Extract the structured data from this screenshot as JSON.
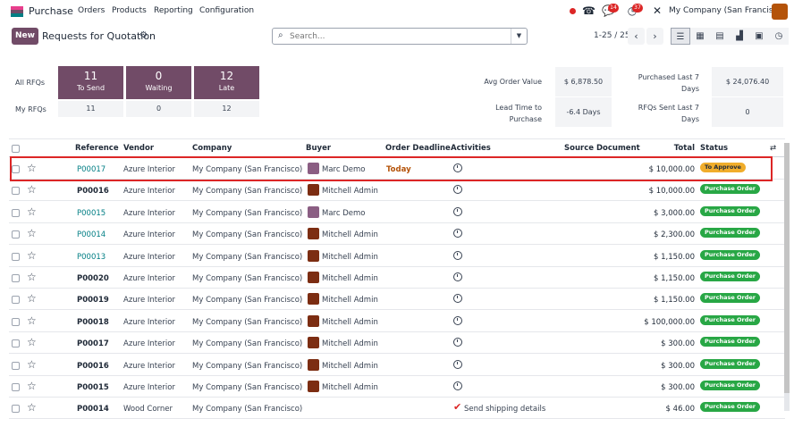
{
  "nav": {
    "app_name": "Purchase",
    "menu": [
      "Orders",
      "Products",
      "Reporting",
      "Configuration"
    ],
    "messages_badge": "14",
    "activities_badge": "37",
    "company": "My Company (San Francisco)"
  },
  "control": {
    "new_label": "New",
    "title": "Requests for Quotation",
    "search_placeholder": "Search...",
    "pager": "1-25 / 25"
  },
  "dashboard": {
    "all_rfqs_label": "All RFQs",
    "my_rfqs_label": "My RFQs",
    "cards": [
      {
        "num": "11",
        "label": "To Send",
        "my": "11"
      },
      {
        "num": "0",
        "label": "Waiting",
        "my": "0"
      },
      {
        "num": "12",
        "label": "Late",
        "my": "12"
      }
    ],
    "avg_order_label": "Avg Order Value",
    "avg_order_value": "$ 6,878.50",
    "lead_time_label": "Lead Time to Purchase",
    "lead_time_value": "-6.4 Days",
    "purchased_label": "Purchased Last 7 Days",
    "purchased_value": "$ 24,076.40",
    "rfqs_sent_label": "RFQs Sent Last 7 Days",
    "rfqs_sent_value": "0"
  },
  "table": {
    "headers": [
      "Reference",
      "Vendor",
      "Company",
      "Buyer",
      "Order Deadline",
      "Activities",
      "Source Document",
      "Total",
      "Status"
    ],
    "rows": [
      {
        "ref": "P00017",
        "vendor": "Azure Interior",
        "company": "My Company (San Francisco)",
        "buyer": "Marc Demo",
        "deadline": "Today",
        "total": "$ 10,000.00",
        "status": "To Approve"
      },
      {
        "ref": "P00016",
        "vendor": "Azure Interior",
        "company": "My Company (San Francisco)",
        "buyer": "Mitchell Admin",
        "deadline": "",
        "total": "$ 10,000.00",
        "status": "Purchase Order"
      },
      {
        "ref": "P00015",
        "vendor": "Azure Interior",
        "company": "My Company (San Francisco)",
        "buyer": "Marc Demo",
        "deadline": "",
        "total": "$ 3,000.00",
        "status": "Purchase Order"
      },
      {
        "ref": "P00014",
        "vendor": "Azure Interior",
        "company": "My Company (San Francisco)",
        "buyer": "Mitchell Admin",
        "deadline": "",
        "total": "$ 2,300.00",
        "status": "Purchase Order"
      },
      {
        "ref": "P00013",
        "vendor": "Azure Interior",
        "company": "My Company (San Francisco)",
        "buyer": "Mitchell Admin",
        "deadline": "",
        "total": "$ 1,150.00",
        "status": "Purchase Order"
      },
      {
        "ref": "P00020",
        "vendor": "Azure Interior",
        "company": "My Company (San Francisco)",
        "buyer": "Mitchell Admin",
        "deadline": "",
        "total": "$ 1,150.00",
        "status": "Purchase Order"
      },
      {
        "ref": "P00019",
        "vendor": "Azure Interior",
        "company": "My Company (San Francisco)",
        "buyer": "Mitchell Admin",
        "deadline": "",
        "total": "$ 1,150.00",
        "status": "Purchase Order"
      },
      {
        "ref": "P00018",
        "vendor": "Azure Interior",
        "company": "My Company (San Francisco)",
        "buyer": "Mitchell Admin",
        "deadline": "",
        "total": "$ 100,000.00",
        "status": "Purchase Order"
      },
      {
        "ref": "P00017",
        "vendor": "Azure Interior",
        "company": "My Company (San Francisco)",
        "buyer": "Mitchell Admin",
        "deadline": "",
        "total": "$ 300.00",
        "status": "Purchase Order"
      },
      {
        "ref": "P00016",
        "vendor": "Azure Interior",
        "company": "My Company (San Francisco)",
        "buyer": "Mitchell Admin",
        "deadline": "",
        "total": "$ 300.00",
        "status": "Purchase Order"
      },
      {
        "ref": "P00015",
        "vendor": "Azure Interior",
        "company": "My Company (San Francisco)",
        "buyer": "Mitchell Admin",
        "deadline": "",
        "total": "$ 300.00",
        "status": "Purchase Order"
      },
      {
        "ref": "P00014",
        "vendor": "Wood Corner",
        "company": "My Company (San Francisco)",
        "buyer": "",
        "deadline": "",
        "activity_text": "Send shipping details",
        "total": "$ 46.00",
        "status": "Purchase Order"
      }
    ]
  },
  "colors": {
    "brand": "#714B67",
    "link": "#017e84",
    "status_green": "#28a745",
    "status_orange": "#f0ad2b",
    "highlight": "#dc2626"
  }
}
